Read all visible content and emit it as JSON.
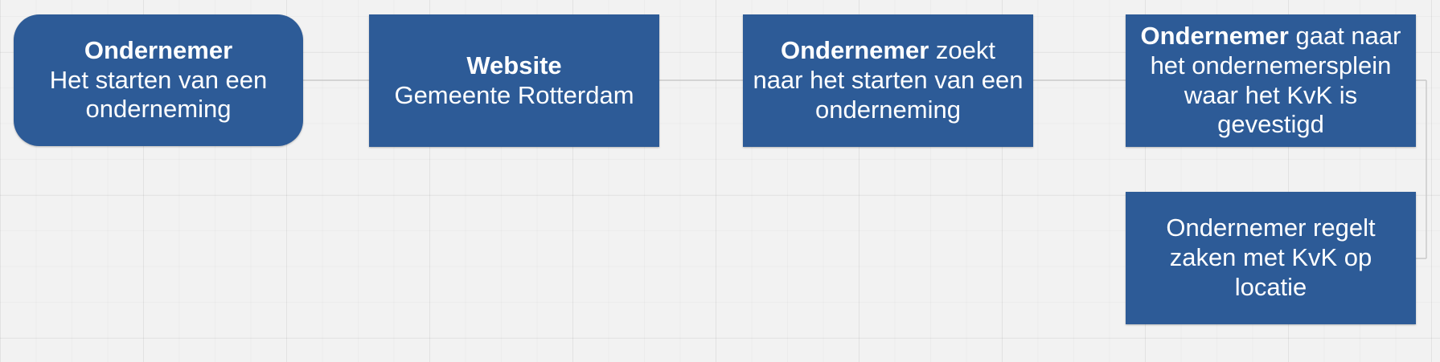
{
  "diagram": {
    "colors": {
      "node_fill": "#2d5b97",
      "node_text": "#ffffff",
      "connector": "#c9c9c9",
      "canvas": "#f2f2f2"
    },
    "nodes": [
      {
        "id": "n1",
        "shape": "rounded-rectangle",
        "bold": "Ondernemer",
        "text": "Het starten van een onderneming"
      },
      {
        "id": "n2",
        "shape": "rectangle",
        "bold": "Website",
        "text": "Gemeente Rotterdam"
      },
      {
        "id": "n3",
        "shape": "rectangle",
        "bold": "Ondernemer",
        "text": "zoekt naar het starten van een onderneming"
      },
      {
        "id": "n4",
        "shape": "rectangle",
        "bold": "Ondernemer",
        "text": "gaat naar het ondernemersplein waar het KvK is gevestigd"
      },
      {
        "id": "n5",
        "shape": "rectangle",
        "bold": "",
        "text": "Ondernemer regelt zaken met KvK op locatie"
      }
    ],
    "edges": [
      {
        "from": "n1",
        "to": "n2"
      },
      {
        "from": "n2",
        "to": "n3"
      },
      {
        "from": "n3",
        "to": "n4"
      },
      {
        "from": "n4",
        "to": "n5"
      }
    ]
  }
}
